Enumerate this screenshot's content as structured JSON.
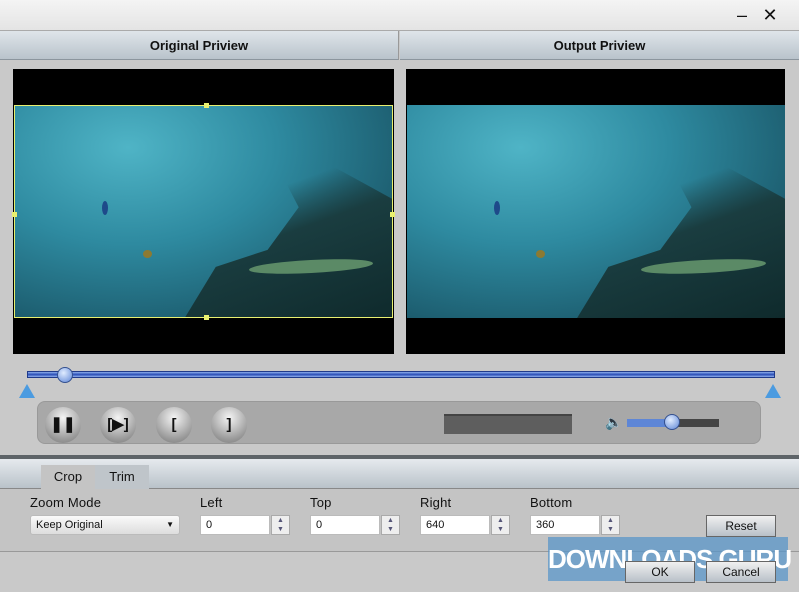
{
  "window": {
    "minimize_icon": "minimize-icon",
    "close_icon": "close-icon"
  },
  "headers": {
    "original": "Original Priview",
    "output": "Output Priview"
  },
  "player": {
    "pause_icon": "pause-icon",
    "step_icon": "next-frame-icon",
    "mark_in": "[",
    "mark_out": "]",
    "progress": 0.05,
    "volume": 0.5,
    "time_display": ""
  },
  "tabs": [
    {
      "label": "Crop",
      "active": true
    },
    {
      "label": "Trim",
      "active": false
    }
  ],
  "crop": {
    "zoom_mode_label": "Zoom Mode",
    "zoom_mode_value": "Keep Original",
    "left_label": "Left",
    "left_value": "0",
    "top_label": "Top",
    "top_value": "0",
    "right_label": "Right",
    "right_value": "640",
    "bottom_label": "Bottom",
    "bottom_value": "360",
    "reset": "Reset"
  },
  "footer": {
    "ok": "OK",
    "cancel": "Cancel"
  },
  "watermark": "DOWNLOADS.GURU"
}
